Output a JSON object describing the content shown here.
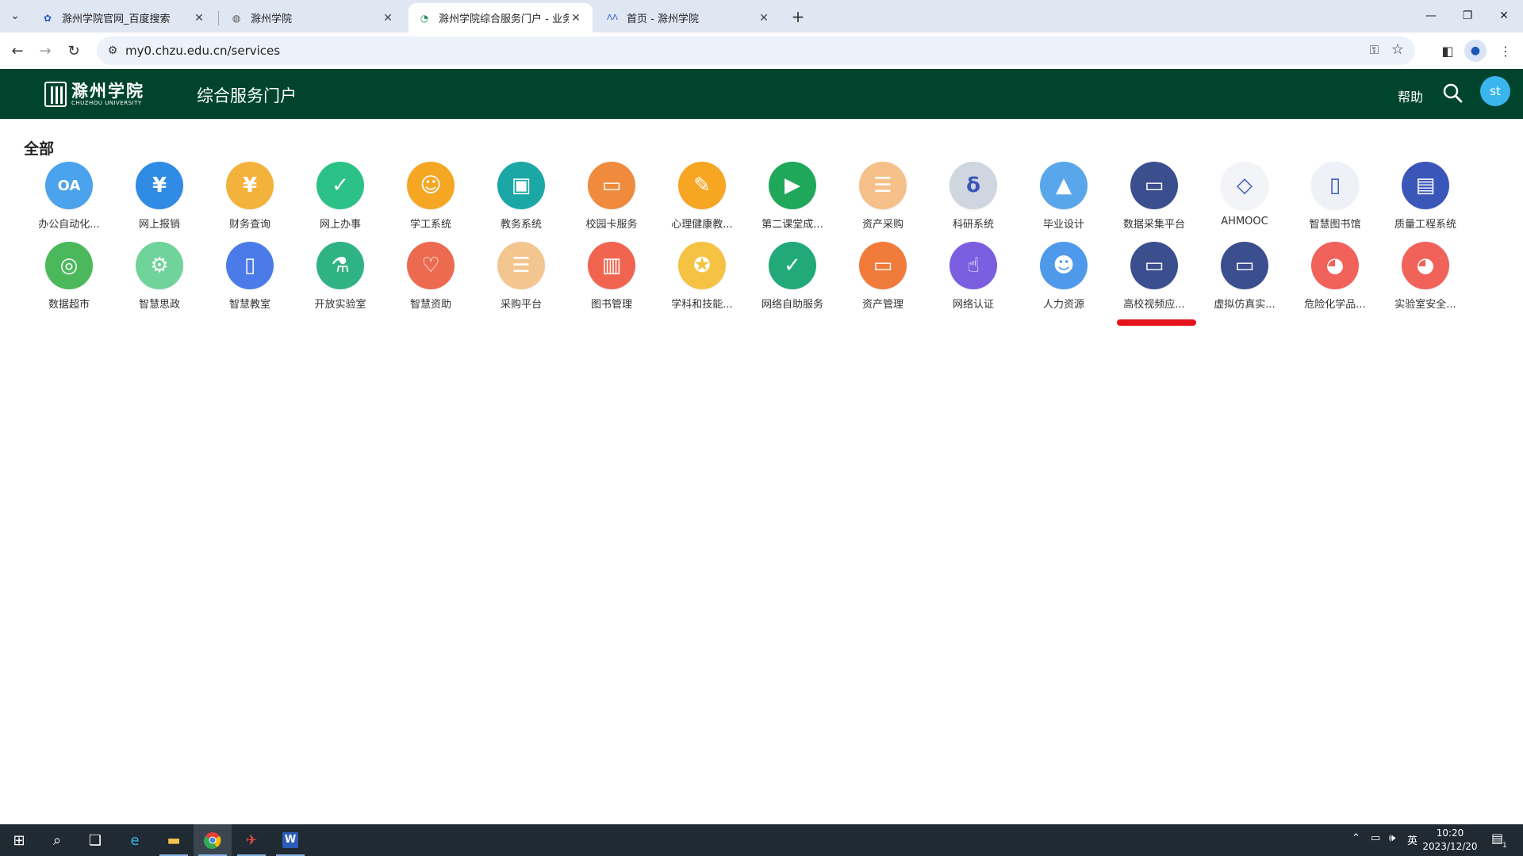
{
  "browser": {
    "tabs": [
      {
        "title": "滁州学院官网_百度搜索",
        "icon": "baidu-paw-icon",
        "active": false
      },
      {
        "title": "滁州学院",
        "icon": "globe-icon",
        "active": false
      },
      {
        "title": "滁州学院综合服务门户 - 业务系",
        "icon": "portal-icon",
        "active": true
      },
      {
        "title": "首页 - 滁州学院",
        "icon": "school-logo-icon",
        "active": false
      }
    ],
    "url": "my0.chzu.edu.cn/services"
  },
  "header": {
    "logo_cn": "滁州学院",
    "logo_en": "CHUZHOU UNIVERSITY",
    "title": "综合服务门户",
    "help": "帮助",
    "avatar": "st"
  },
  "section": {
    "title": "全部"
  },
  "apps": [
    {
      "label": "办公自动化...",
      "glyph": "OA",
      "color": "#4aa3ec",
      "icon": "oa-monitor-icon"
    },
    {
      "label": "网上报销",
      "glyph": "¥",
      "color": "#2f8be3",
      "icon": "yen-hand-icon"
    },
    {
      "label": "财务查询",
      "glyph": "¥",
      "color": "#f3b23b",
      "icon": "finance-doc-icon"
    },
    {
      "label": "网上办事",
      "glyph": "✓",
      "color": "#2cc287",
      "icon": "check-circle-icon"
    },
    {
      "label": "学工系统",
      "glyph": "☺",
      "color": "#f5a623",
      "icon": "graduate-person-icon"
    },
    {
      "label": "教务系统",
      "glyph": "▣",
      "color": "#1aa7a6",
      "icon": "devices-icon"
    },
    {
      "label": "校园卡服务",
      "glyph": "▭",
      "color": "#f08a3c",
      "icon": "campus-card-icon"
    },
    {
      "label": "心理健康教...",
      "glyph": "✎",
      "color": "#f6a623",
      "icon": "note-pen-icon"
    },
    {
      "label": "第二课堂成...",
      "glyph": "▶",
      "color": "#1fa85a",
      "icon": "play-diamond-icon"
    },
    {
      "label": "资产采购",
      "glyph": "☰",
      "color": "#f5c089",
      "icon": "clipboard-icon"
    },
    {
      "label": "科研系统",
      "glyph": "δ",
      "color": "#cfd6e0",
      "icon": "microscope-science-icon"
    },
    {
      "label": "毕业设计",
      "glyph": "▲",
      "color": "#5aa6ea",
      "icon": "graduation-cap-icon"
    },
    {
      "label": "数据采集平台",
      "glyph": "▭",
      "color": "#3b4f8f",
      "icon": "laptop-icon"
    },
    {
      "label": "AHMOOC",
      "glyph": "◇",
      "color": "#f2f4f8",
      "icon": "network-nodes-icon"
    },
    {
      "label": "智慧图书馆",
      "glyph": "▯",
      "color": "#eef2f8",
      "icon": "bookmark-book-icon"
    },
    {
      "label": "质量工程系统",
      "glyph": "▤",
      "color": "#3a56b8",
      "icon": "open-book-icon"
    },
    {
      "label": "数据超市",
      "glyph": "◎",
      "color": "#4cb85c",
      "icon": "database-coins-icon"
    },
    {
      "label": "智慧思政",
      "glyph": "⚙",
      "color": "#6fd39a",
      "icon": "gear-magnifier-icon"
    },
    {
      "label": "智慧教室",
      "glyph": "▯",
      "color": "#4a7be8",
      "icon": "door-icon"
    },
    {
      "label": "开放实验室",
      "glyph": "⚗",
      "color": "#30b384",
      "icon": "flask-icon"
    },
    {
      "label": "智慧资助",
      "glyph": "♡",
      "color": "#ec6a4f",
      "icon": "hand-heart-icon"
    },
    {
      "label": "采购平台",
      "glyph": "☰",
      "color": "#f3c690",
      "icon": "clipboard-list-icon"
    },
    {
      "label": "图书管理",
      "glyph": "▥",
      "color": "#f16450",
      "icon": "book-icon"
    },
    {
      "label": "学科和技能...",
      "glyph": "✪",
      "color": "#f5c243",
      "icon": "award-ribbon-icon"
    },
    {
      "label": "网络自助服务",
      "glyph": "✓",
      "color": "#22a97a",
      "icon": "monitor-check-icon"
    },
    {
      "label": "资产管理",
      "glyph": "▭",
      "color": "#f07b3a",
      "icon": "presentation-screen-icon"
    },
    {
      "label": "网络认证",
      "glyph": "☝",
      "color": "#7b5fe0",
      "icon": "wifi-finger-icon"
    },
    {
      "label": "人力资源",
      "glyph": "☻",
      "color": "#4f99ea",
      "icon": "people-icon"
    },
    {
      "label": "高校视频应...",
      "glyph": "▭",
      "color": "#3b4f8f",
      "icon": "laptop-icon"
    },
    {
      "label": "虚拟仿真实...",
      "glyph": "▭",
      "color": "#3b4f8f",
      "icon": "laptop-icon"
    },
    {
      "label": "危险化学品...",
      "glyph": "◕",
      "color": "#f1625a",
      "icon": "hazard-chemical-icon"
    },
    {
      "label": "实验室安全...",
      "glyph": "◕",
      "color": "#f1625a",
      "icon": "lab-safety-icon"
    }
  ],
  "taskbar": {
    "ime": "英",
    "time": "10:20",
    "date": "2023/12/20",
    "notifications": "1"
  }
}
